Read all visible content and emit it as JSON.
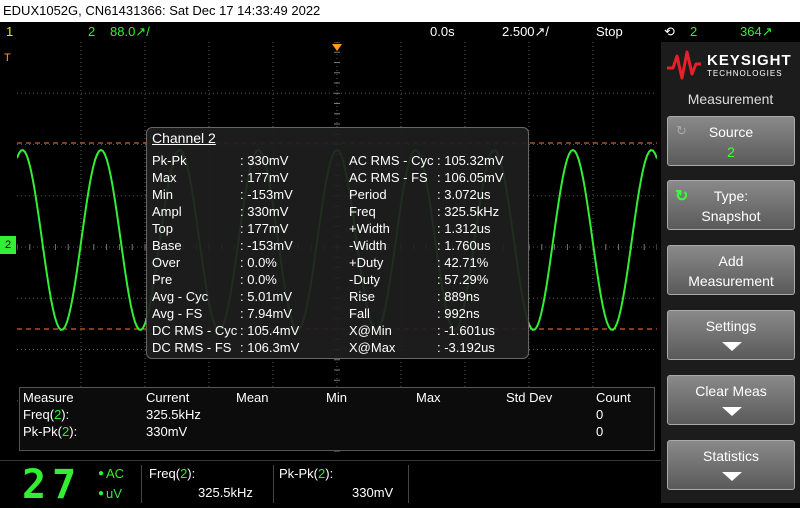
{
  "title": "EDUX1052G, CN61431366: Sat Dec 17 14:33:49 2022",
  "topbar": {
    "ch1": "1",
    "ch2": "2",
    "ch2_scale": "88.0↗/",
    "delay": "0.0s",
    "timebase": "2.500↗/",
    "run_state": "Stop",
    "trigger_source": "2",
    "trigger_level": "364↗"
  },
  "colors": {
    "ch1": "#e8e800",
    "ch2": "#33ee33",
    "ref": "#ff7a3d",
    "trigger": "#ff9c1a"
  },
  "logo": {
    "line1": "KEYSIGHT",
    "line2": "TECHNOLOGIES"
  },
  "panel": {
    "title": "Measurement",
    "buttons": [
      {
        "label": "Source",
        "value": "2"
      },
      {
        "label": "Type:",
        "value": "Snapshot"
      },
      {
        "label": "Add",
        "value": "Measurement"
      },
      {
        "label": "Settings",
        "value": ""
      },
      {
        "label": "Clear Meas",
        "value": ""
      },
      {
        "label": "Statistics",
        "value": ""
      }
    ]
  },
  "snapshot": {
    "channel": "Channel 2",
    "left": [
      {
        "k": "Pk-Pk",
        "v": ": 330mV"
      },
      {
        "k": "Max",
        "v": ": 177mV"
      },
      {
        "k": "Min",
        "v": ": -153mV"
      },
      {
        "k": "Ampl",
        "v": ": 330mV"
      },
      {
        "k": "Top",
        "v": ": 177mV"
      },
      {
        "k": "Base",
        "v": ": -153mV"
      },
      {
        "k": "Over",
        "v": ": 0.0%"
      },
      {
        "k": "Pre",
        "v": ": 0.0%"
      },
      {
        "k": "Avg - Cyc",
        "v": ": 5.01mV"
      },
      {
        "k": "Avg - FS",
        "v": ": 7.94mV"
      },
      {
        "k": "DC RMS - Cyc",
        "v": ": 105.4mV"
      },
      {
        "k": "DC RMS - FS",
        "v": ": 106.3mV"
      }
    ],
    "right": [
      {
        "k": "AC RMS - Cyc",
        "v": ": 105.32mV"
      },
      {
        "k": "AC RMS - FS",
        "v": ": 106.05mV"
      },
      {
        "k": "Period",
        "v": ": 3.072us"
      },
      {
        "k": "Freq",
        "v": ": 325.5kHz"
      },
      {
        "k": "+Width",
        "v": ": 1.312us"
      },
      {
        "k": "-Width",
        "v": ": 1.760us"
      },
      {
        "k": "+Duty",
        "v": ": 42.71%"
      },
      {
        "k": "-Duty",
        "v": ": 57.29%"
      },
      {
        "k": "Rise",
        "v": ": 889ns"
      },
      {
        "k": "Fall",
        "v": ": 992ns"
      },
      {
        "k": "X@Min",
        "v": ": -1.601us"
      },
      {
        "k": "X@Max",
        "v": ": -3.192us"
      }
    ]
  },
  "meas_table": {
    "headers": [
      "Measure",
      "Current",
      "Mean",
      "Min",
      "Max",
      "Std Dev",
      "Count"
    ],
    "rows": [
      {
        "name": "Freq(",
        "src": "2",
        "close": "):",
        "current": "325.5kHz",
        "count": "0"
      },
      {
        "name": "Pk-Pk(",
        "src": "2",
        "close": "):",
        "current": "330mV",
        "count": "0"
      }
    ]
  },
  "bottom": {
    "digits": "27",
    "coupling": "AC",
    "units": "uV",
    "m1_label": "Freq(",
    "m1_src": "2",
    "m1_close": "):",
    "m1_value": "325.5kHz",
    "m2_label": "Pk-Pk(",
    "m2_src": "2",
    "m2_close": "):",
    "m2_value": "330mV"
  },
  "markers": {
    "trigger_t": "T",
    "ch2_marker": "2"
  }
}
